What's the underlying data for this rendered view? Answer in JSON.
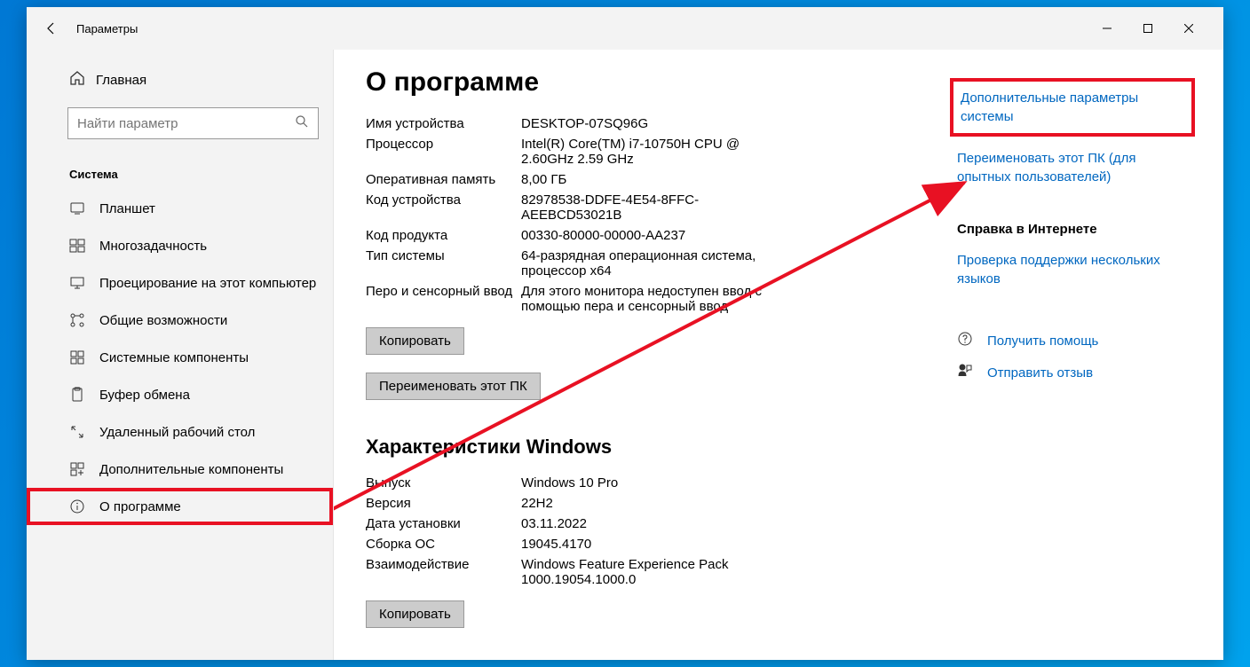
{
  "window": {
    "title": "Параметры"
  },
  "sidebar": {
    "home": "Главная",
    "search_placeholder": "Найти параметр",
    "section": "Система",
    "items": [
      {
        "label": "Планшет"
      },
      {
        "label": "Многозадачность"
      },
      {
        "label": "Проецирование на этот компьютер"
      },
      {
        "label": "Общие возможности"
      },
      {
        "label": "Системные компоненты"
      },
      {
        "label": "Буфер обмена"
      },
      {
        "label": "Удаленный рабочий стол"
      },
      {
        "label": "Дополнительные компоненты"
      },
      {
        "label": "О программе"
      }
    ]
  },
  "content": {
    "title": "О программе",
    "device_specs": [
      {
        "label": "Имя устройства",
        "value": "DESKTOP-07SQ96G"
      },
      {
        "label": "Процессор",
        "value": "Intel(R) Core(TM) i7-10750H CPU @ 2.60GHz   2.59 GHz"
      },
      {
        "label": "Оперативная память",
        "value": "8,00 ГБ"
      },
      {
        "label": "Код устройства",
        "value": "82978538-DDFE-4E54-8FFC-AEEBCD53021B"
      },
      {
        "label": "Код продукта",
        "value": "00330-80000-00000-AA237"
      },
      {
        "label": "Тип системы",
        "value": "64-разрядная операционная система, процессор x64"
      },
      {
        "label": "Перо и сенсорный ввод",
        "value": "Для этого монитора недоступен ввод с помощью пера и сенсорный ввод"
      }
    ],
    "copy_btn": "Копировать",
    "rename_btn": "Переименовать этот ПК",
    "windows_title": "Характеристики Windows",
    "windows_specs": [
      {
        "label": "Выпуск",
        "value": "Windows 10 Pro"
      },
      {
        "label": "Версия",
        "value": "22H2"
      },
      {
        "label": "Дата установки",
        "value": "03.11.2022"
      },
      {
        "label": "Сборка ОС",
        "value": "19045.4170"
      },
      {
        "label": "Взаимодействие",
        "value": "Windows Feature Experience Pack 1000.19054.1000.0"
      }
    ],
    "copy_btn2": "Копировать"
  },
  "side": {
    "link1": "Дополнительные параметры системы",
    "link2": "Переименовать этот ПК (для опытных пользователей)",
    "heading1": "Справка в Интернете",
    "link3": "Проверка поддержки нескольких языков",
    "help1": "Получить помощь",
    "help2": "Отправить отзыв"
  }
}
